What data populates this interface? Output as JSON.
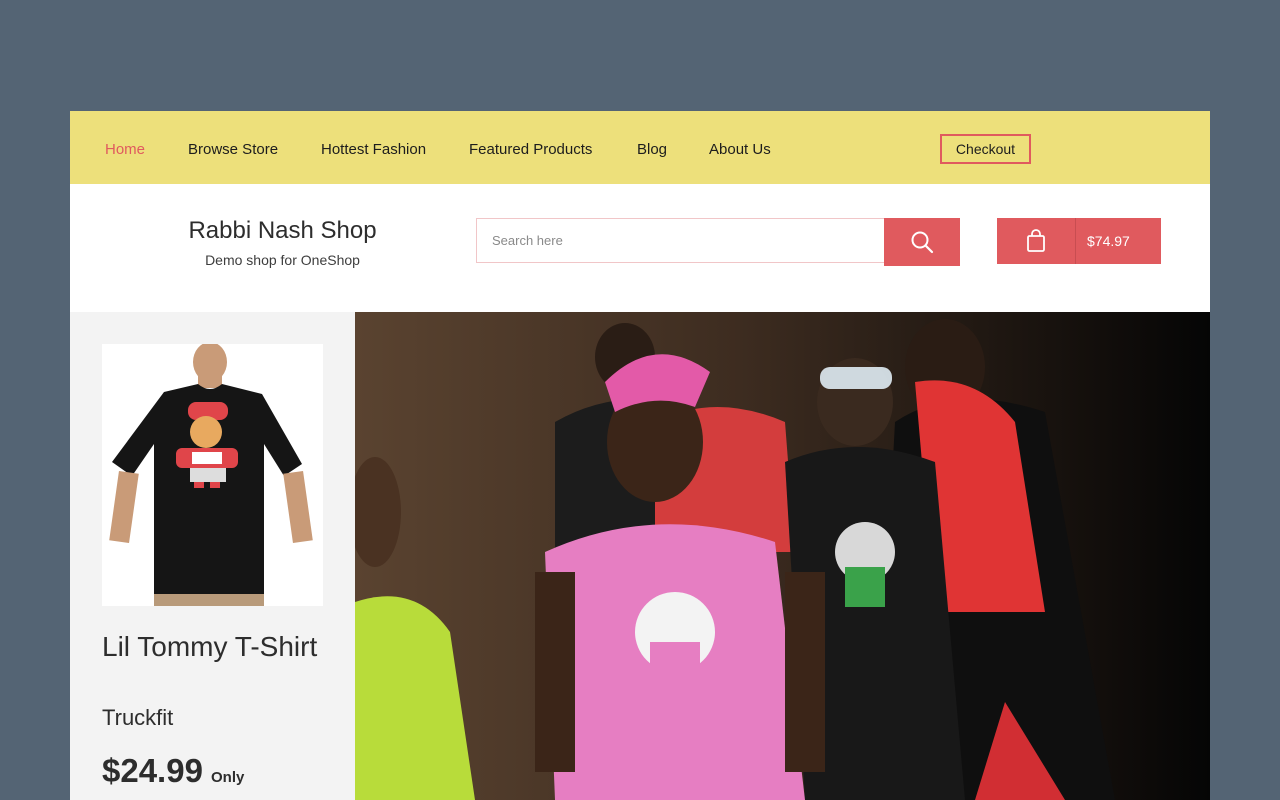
{
  "nav": {
    "items": [
      {
        "label": "Home",
        "active": true
      },
      {
        "label": "Browse Store",
        "active": false
      },
      {
        "label": "Hottest Fashion",
        "active": false
      },
      {
        "label": "Featured Products",
        "active": false
      },
      {
        "label": "Blog",
        "active": false
      },
      {
        "label": "About Us",
        "active": false
      }
    ],
    "checkout_label": "Checkout"
  },
  "header": {
    "shop_name": "Rabbi Nash Shop",
    "tagline": "Demo shop for OneShop",
    "search_placeholder": "Search here",
    "cart_total": "$74.97"
  },
  "product": {
    "name": "Lil Tommy T-Shirt",
    "brand": "Truckfit",
    "price": "$24.99",
    "price_note": "Only"
  },
  "colors": {
    "background": "#546474",
    "nav_bg": "#ede07b",
    "accent": "#e05a5e",
    "sidebar_bg": "#f3f3f3"
  },
  "icons": [
    "search-icon",
    "shopping-bag-icon"
  ]
}
